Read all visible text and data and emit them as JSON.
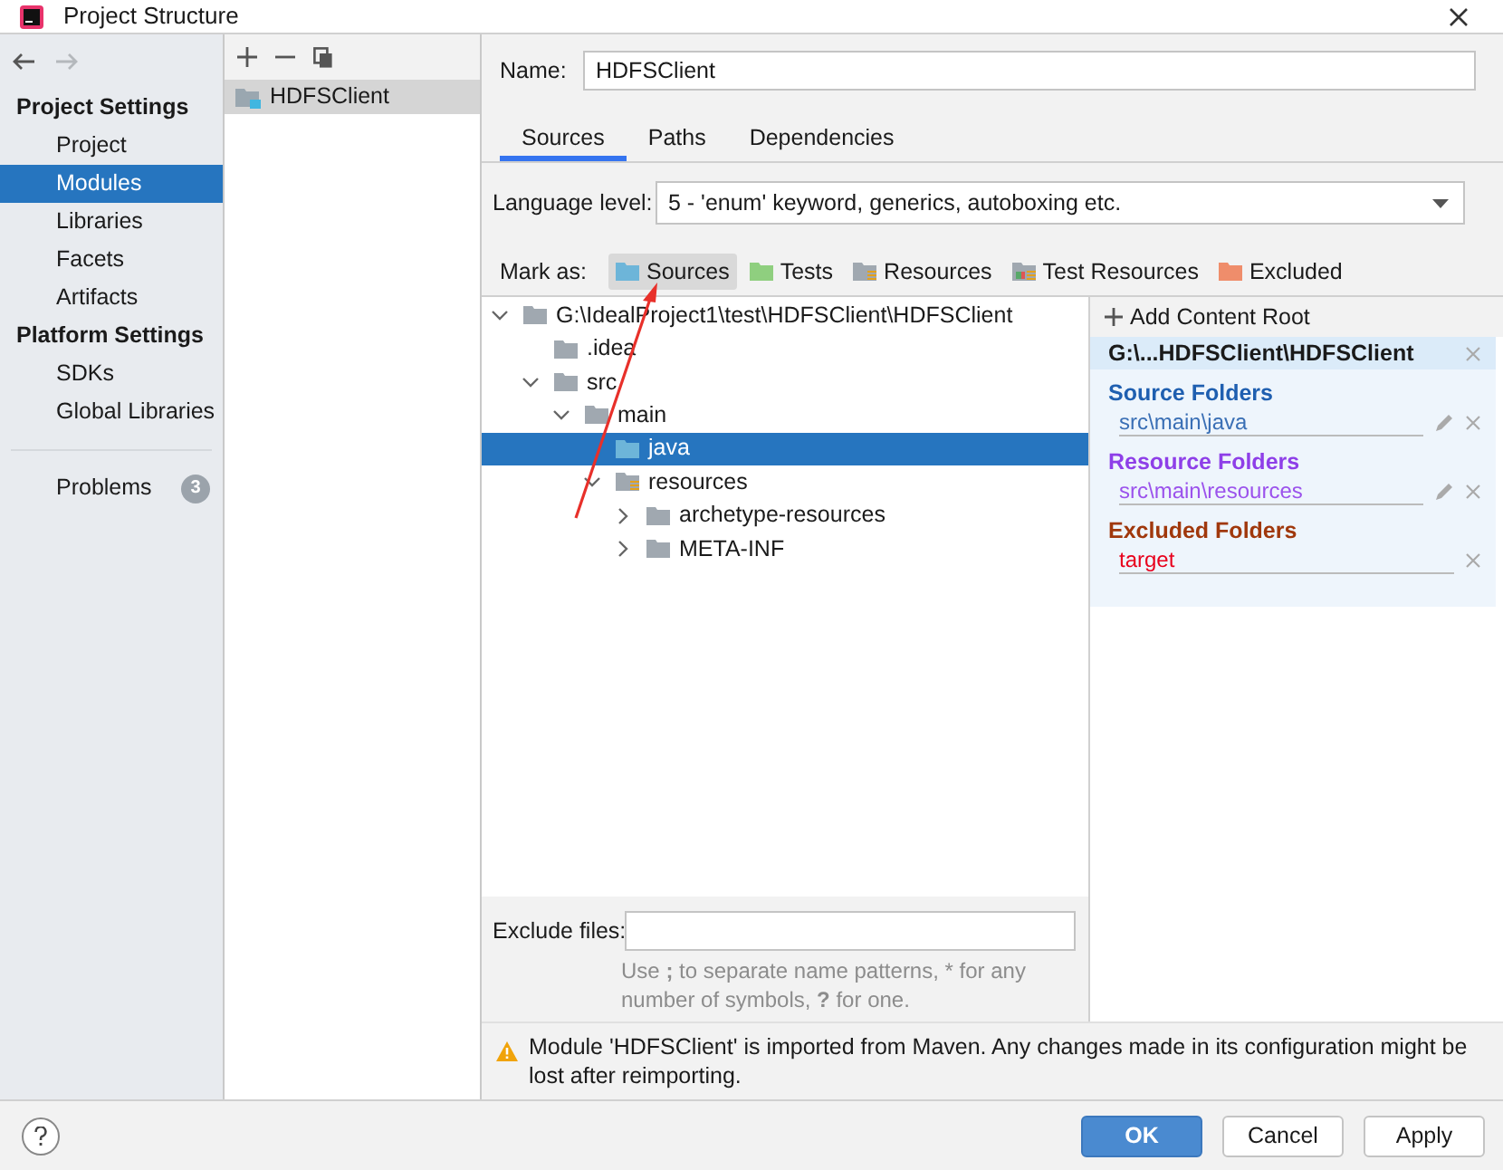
{
  "window": {
    "title": "Project Structure"
  },
  "sidebar": {
    "sections": [
      {
        "heading": "Project Settings",
        "items": [
          {
            "label": "Project",
            "selected": false
          },
          {
            "label": "Modules",
            "selected": true
          },
          {
            "label": "Libraries",
            "selected": false
          },
          {
            "label": "Facets",
            "selected": false
          },
          {
            "label": "Artifacts",
            "selected": false
          }
        ]
      },
      {
        "heading": "Platform Settings",
        "items": [
          {
            "label": "SDKs",
            "selected": false
          },
          {
            "label": "Global Libraries",
            "selected": false
          }
        ]
      }
    ],
    "problems": {
      "label": "Problems",
      "count": "3"
    }
  },
  "modules": [
    {
      "label": "HDFSClient",
      "selected": true
    }
  ],
  "name_field": {
    "label": "Name:",
    "value": "HDFSClient"
  },
  "tabs": [
    {
      "label": "Sources",
      "selected": true
    },
    {
      "label": "Paths",
      "selected": false
    },
    {
      "label": "Dependencies",
      "selected": false
    }
  ],
  "language_level": {
    "label": "Language level:",
    "value": "5 - 'enum' keyword, generics, autoboxing etc."
  },
  "mark_as": {
    "label": "Mark as:",
    "buttons": [
      {
        "label": "Sources",
        "kind": "source",
        "selected": true
      },
      {
        "label": "Tests",
        "kind": "test",
        "selected": false
      },
      {
        "label": "Resources",
        "kind": "resource",
        "selected": false
      },
      {
        "label": "Test Resources",
        "kind": "testresource",
        "selected": false
      },
      {
        "label": "Excluded",
        "kind": "excluded",
        "selected": false
      }
    ]
  },
  "tree": [
    {
      "label": "G:\\IdealProject1\\test\\HDFSClient\\HDFSClient",
      "kind": "folder",
      "expanded": true,
      "selected": false,
      "children": [
        {
          "label": ".idea",
          "kind": "folder",
          "selected": false
        },
        {
          "label": "src",
          "kind": "folder",
          "expanded": true,
          "selected": false,
          "children": [
            {
              "label": "main",
              "kind": "folder",
              "expanded": true,
              "selected": false,
              "children": [
                {
                  "label": "java",
                  "kind": "source",
                  "selected": true
                },
                {
                  "label": "resources",
                  "kind": "resource",
                  "expanded": true,
                  "selected": false,
                  "children": [
                    {
                      "label": "archetype-resources",
                      "kind": "folder",
                      "expanded": false,
                      "selected": false
                    },
                    {
                      "label": "META-INF",
                      "kind": "folder",
                      "expanded": false,
                      "selected": false
                    }
                  ]
                }
              ]
            }
          ]
        }
      ]
    }
  ],
  "exclude_files": {
    "label": "Exclude files:",
    "hint": "Use **;** to separate name patterns, * for any number of symbols, **?** for one."
  },
  "content_root": {
    "add_label": "Add Content Root",
    "path": "G:\\...HDFSClient\\HDFSClient",
    "groups": [
      {
        "title": "Source Folders",
        "kind": "source",
        "color": "#1f5fb0",
        "items": [
          {
            "label": "src\\main\\java",
            "editable": true
          }
        ]
      },
      {
        "title": "Resource Folders",
        "kind": "resource",
        "color": "#8e3fe8",
        "items": [
          {
            "label": "src\\main\\resources",
            "editable": true
          }
        ]
      },
      {
        "title": "Excluded Folders",
        "kind": "excluded",
        "color": "#a0380c",
        "items": [
          {
            "label": "target",
            "editable": false
          }
        ]
      }
    ]
  },
  "warning": "Module 'HDFSClient' is imported from Maven. Any changes made in its configuration might be lost after reimporting.",
  "buttons": [
    {
      "label": "OK",
      "kind": "primary"
    },
    {
      "label": "Cancel",
      "kind": "normal"
    },
    {
      "label": "Apply",
      "kind": "normal"
    }
  ]
}
